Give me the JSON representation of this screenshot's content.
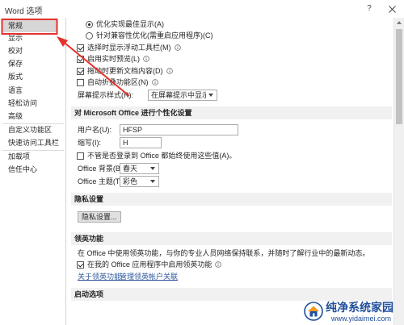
{
  "window": {
    "title": "Word 选项",
    "help_label": "?"
  },
  "sidebar": {
    "items": [
      {
        "label": "常规",
        "selected": true
      },
      {
        "label": "显示",
        "selected": false
      },
      {
        "label": "校对",
        "selected": false
      },
      {
        "label": "保存",
        "selected": false
      },
      {
        "label": "版式",
        "selected": false
      },
      {
        "label": "语言",
        "selected": false
      },
      {
        "label": "轻松访问",
        "selected": false
      },
      {
        "label": "高级",
        "selected": false
      },
      {
        "label": "自定义功能区",
        "selected": false
      },
      {
        "label": "快速访问工具栏",
        "selected": false
      },
      {
        "label": "加载项",
        "selected": false
      },
      {
        "label": "信任中心",
        "selected": false
      }
    ]
  },
  "ui_options": {
    "display_radios": [
      {
        "label": "优化实现最佳显示(A)",
        "selected": true
      },
      {
        "label": "针对兼容性优化(需重启应用程序)(C)",
        "selected": false
      }
    ],
    "checkboxes": [
      {
        "label": "选择时显示浮动工具栏(M)",
        "checked": true
      },
      {
        "label": "启用实时预览(L)",
        "checked": true
      },
      {
        "label": "拖动时更新文档内容(D)",
        "checked": true
      },
      {
        "label": "自动折叠功能区(N)",
        "checked": false
      }
    ],
    "screentip_label": "屏幕提示样式(R):",
    "screentip_value": "在屏幕提示中显示功能说明"
  },
  "personalize": {
    "header": "对 Microsoft Office 进行个性化设置",
    "username_label": "用户名(U):",
    "username_value": "HFSP",
    "initials_label": "缩写(I):",
    "initials_value": "H",
    "always_use_label": "不管是否登录到 Office 都始终使用这些值(A)。",
    "always_use_checked": false,
    "background_label": "Office 背景(B):",
    "background_value": "春天",
    "theme_label": "Office 主题(T):",
    "theme_value": "彩色"
  },
  "privacy": {
    "header": "隐私设置",
    "button_label": "隐私设置..."
  },
  "linkedin": {
    "header": "领英功能",
    "description": "在 Office 中使用领英功能，与你的专业人员网络保持联系，并随时了解行业中的最新动态。",
    "enable_label": "在我的 Office 应用程序中启用领英功能",
    "enable_checked": true,
    "about_link": "关于领英功能",
    "manage_link": "管理领英帐户关联"
  },
  "startup": {
    "header": "启动选项"
  },
  "watermark": {
    "name": "纯净系统家园",
    "url": "www.yidaimei.com"
  },
  "icons": {
    "help": "help-icon",
    "close": "close-icon",
    "info": "info-icon",
    "dropdown": "chevron-down-icon",
    "scroll_up": "chevron-up-icon",
    "watermark_logo": "house-logo-icon"
  },
  "colors": {
    "annotation_red": "#e5322d",
    "link": "#2b579a",
    "selected_item_bg": "#d6d6d6",
    "section_header_bg": "#f1f1f1",
    "watermark_blue": "#1f4e9a"
  }
}
